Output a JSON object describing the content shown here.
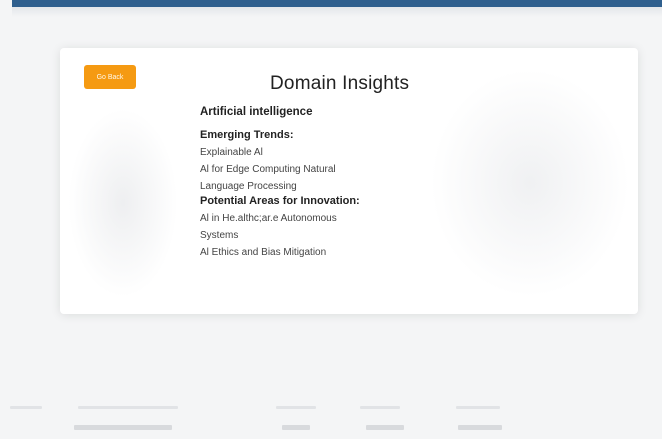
{
  "header": {
    "accent_color": "#2f5f8e"
  },
  "card": {
    "back_button_label": "Go Back",
    "back_button_color": "#f59a12",
    "title": "Domain Insights"
  },
  "insights": {
    "domain": "Artificial intelligence",
    "emerging_trends": {
      "heading": "Emerging Trends:",
      "items": [
        "Explainable Al",
        "Al for Edge Computing Natural",
        "Language Processing"
      ]
    },
    "innovation_areas": {
      "heading": "Potential Areas for Innovation:",
      "items": [
        "Al in He.althc;ar.e Autonomous",
        "Systems",
        "Al Ethics and Bias Mitigation"
      ]
    }
  }
}
